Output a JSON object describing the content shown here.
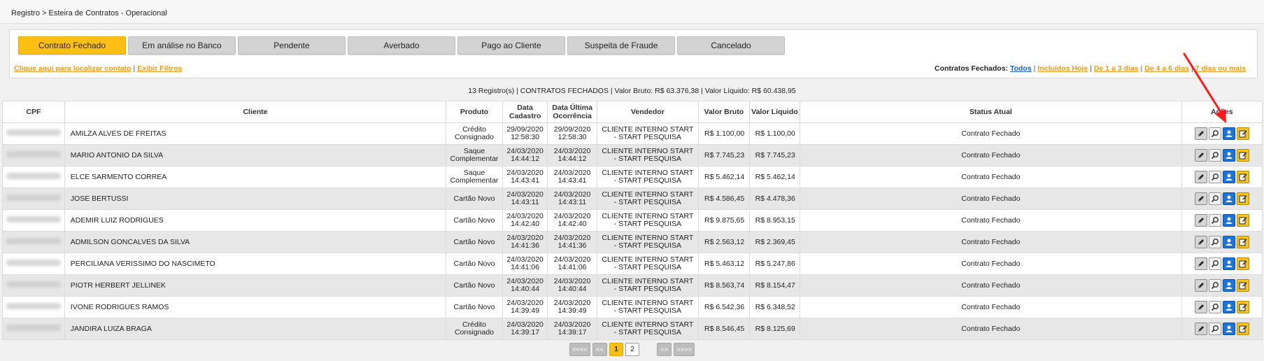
{
  "breadcrumb": "Registro > Esteira de Contratos - Operacional",
  "tabs": [
    {
      "label": "Contrato Fechado",
      "active": true
    },
    {
      "label": "Em análise no Banco"
    },
    {
      "label": "Pendente"
    },
    {
      "label": "Averbado"
    },
    {
      "label": "Pago ao Cliente"
    },
    {
      "label": "Suspeita de Fraude"
    },
    {
      "label": "Cancelado"
    }
  ],
  "links": {
    "locate": "Clique aqui para localizar contato",
    "filters": "Exibir Filtros",
    "filter_label": "Contratos Fechados:",
    "all": "Todos",
    "today": "Incluídos Hoje",
    "d1_3": "De 1 a 3 dias",
    "d4_6": "De 4 a 6 dias",
    "d7": "7 dias ou mais"
  },
  "summary": "13 Registro(s) | CONTRATOS FECHADOS | Valor Bruto: R$ 63.376,38 | Valor Líquido: R$ 60.438,95",
  "table": {
    "headers": [
      "CPF",
      "Cliente",
      "Produto",
      "Data Cadastro",
      "Data Última Ocorrência",
      "Vendedor",
      "Valor Bruto",
      "Valor Líquido",
      "Status Atual",
      "Ações"
    ],
    "rows": [
      {
        "cliente": "AMILZA ALVES DE FREITAS",
        "produto": "Crédito Consignado",
        "cad_d": "29/09/2020",
        "cad_t": "12:58:30",
        "oc_d": "29/09/2020",
        "oc_t": "12:58:30",
        "vend": "CLIENTE INTERNO START - START PESQUISA",
        "bruto": "R$ 1.100,00",
        "liquido": "R$ 1.100,00",
        "status": "Contrato Fechado"
      },
      {
        "cliente": "MARIO ANTONIO DA SILVA",
        "produto": "Saque Complementar",
        "cad_d": "24/03/2020",
        "cad_t": "14:44:12",
        "oc_d": "24/03/2020",
        "oc_t": "14:44:12",
        "vend": "CLIENTE INTERNO START - START PESQUISA",
        "bruto": "R$ 7.745,23",
        "liquido": "R$ 7.745,23",
        "status": "Contrato Fechado"
      },
      {
        "cliente": "ELCE SARMENTO CORREA",
        "produto": "Saque Complementar",
        "cad_d": "24/03/2020",
        "cad_t": "14:43:41",
        "oc_d": "24/03/2020",
        "oc_t": "14:43:41",
        "vend": "CLIENTE INTERNO START - START PESQUISA",
        "bruto": "R$ 5.462,14",
        "liquido": "R$ 5.462,14",
        "status": "Contrato Fechado"
      },
      {
        "cliente": "JOSE BERTUSSI",
        "produto": "Cartão Novo",
        "cad_d": "24/03/2020",
        "cad_t": "14:43:11",
        "oc_d": "24/03/2020",
        "oc_t": "14:43:11",
        "vend": "CLIENTE INTERNO START - START PESQUISA",
        "bruto": "R$ 4.586,45",
        "liquido": "R$ 4.478,36",
        "status": "Contrato Fechado"
      },
      {
        "cliente": "ADEMIR LUIZ RODRIGUES",
        "produto": "Cartão Novo",
        "cad_d": "24/03/2020",
        "cad_t": "14:42:40",
        "oc_d": "24/03/2020",
        "oc_t": "14:42:40",
        "vend": "CLIENTE INTERNO START - START PESQUISA",
        "bruto": "R$ 9.875,65",
        "liquido": "R$ 8.953,15",
        "status": "Contrato Fechado"
      },
      {
        "cliente": "ADMILSON GONCALVES DA SILVA",
        "produto": "Cartão Novo",
        "cad_d": "24/03/2020",
        "cad_t": "14:41:36",
        "oc_d": "24/03/2020",
        "oc_t": "14:41:36",
        "vend": "CLIENTE INTERNO START - START PESQUISA",
        "bruto": "R$ 2.563,12",
        "liquido": "R$ 2.369,45",
        "status": "Contrato Fechado"
      },
      {
        "cliente": "PERCILIANA VERISSIMO DO NASCIMETO",
        "produto": "Cartão Novo",
        "cad_d": "24/03/2020",
        "cad_t": "14:41:06",
        "oc_d": "24/03/2020",
        "oc_t": "14:41:06",
        "vend": "CLIENTE INTERNO START - START PESQUISA",
        "bruto": "R$ 5.463,12",
        "liquido": "R$ 5.247,86",
        "status": "Contrato Fechado"
      },
      {
        "cliente": "PIOTR HERBERT JELLINEK",
        "produto": "Cartão Novo",
        "cad_d": "24/03/2020",
        "cad_t": "14:40:44",
        "oc_d": "24/03/2020",
        "oc_t": "14:40:44",
        "vend": "CLIENTE INTERNO START - START PESQUISA",
        "bruto": "R$ 8.563,74",
        "liquido": "R$ 8.154,47",
        "status": "Contrato Fechado"
      },
      {
        "cliente": "IVONE RODRIGUES RAMOS",
        "produto": "Cartão Novo",
        "cad_d": "24/03/2020",
        "cad_t": "14:39:49",
        "oc_d": "24/03/2020",
        "oc_t": "14:39:49",
        "vend": "CLIENTE INTERNO START - START PESQUISA",
        "bruto": "R$ 6.542,36",
        "liquido": "R$ 6.348,52",
        "status": "Contrato Fechado"
      },
      {
        "cliente": "JANDIRA LUIZA BRAGA",
        "produto": "Crédito Consignado",
        "cad_d": "24/03/2020",
        "cad_t": "14:39:17",
        "oc_d": "24/03/2020",
        "oc_t": "14:39:17",
        "vend": "CLIENTE INTERNO START - START PESQUISA",
        "bruto": "R$ 8.546,45",
        "liquido": "R$ 8.125,69",
        "status": "Contrato Fechado"
      }
    ]
  },
  "pager": {
    "first": "««««",
    "prev": "««",
    "pages": [
      "1",
      "2"
    ],
    "current": "1",
    "next": "»»",
    "last": "»»»»"
  },
  "icons": {
    "edit": "pencil-icon",
    "search": "magnifier-icon",
    "user": "user-icon",
    "note": "note-edit-icon"
  },
  "colors": {
    "accent": "#fdc012",
    "link_orange": "#f39a18",
    "link_blue": "#1b5fc4",
    "user_blue": "#1e73d8",
    "arrow": "#ff0000"
  }
}
